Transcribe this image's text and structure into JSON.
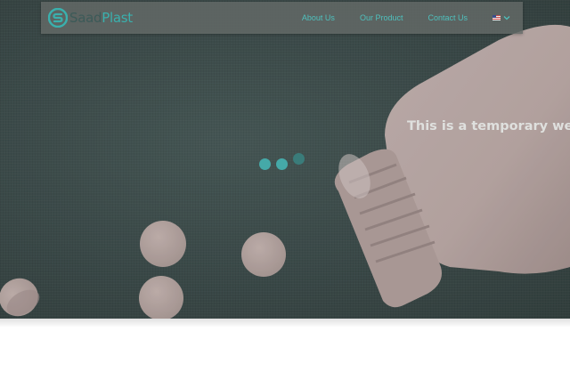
{
  "brand": {
    "name_part1": "Saad",
    "name_part2": "Plast",
    "colors": {
      "accent": "#3ab0ad",
      "dark": "#3c5a58"
    }
  },
  "nav": {
    "items": [
      {
        "label": "About Us"
      },
      {
        "label": "Our Product"
      },
      {
        "label": "Contact Us"
      }
    ],
    "language": {
      "flag_icon": "us-flag-icon",
      "dropdown_icon": "chevron-down-icon"
    }
  },
  "hero": {
    "headline": "This is a temporary websit"
  },
  "loader": {
    "dots": 3,
    "color": "#45a9a8"
  }
}
